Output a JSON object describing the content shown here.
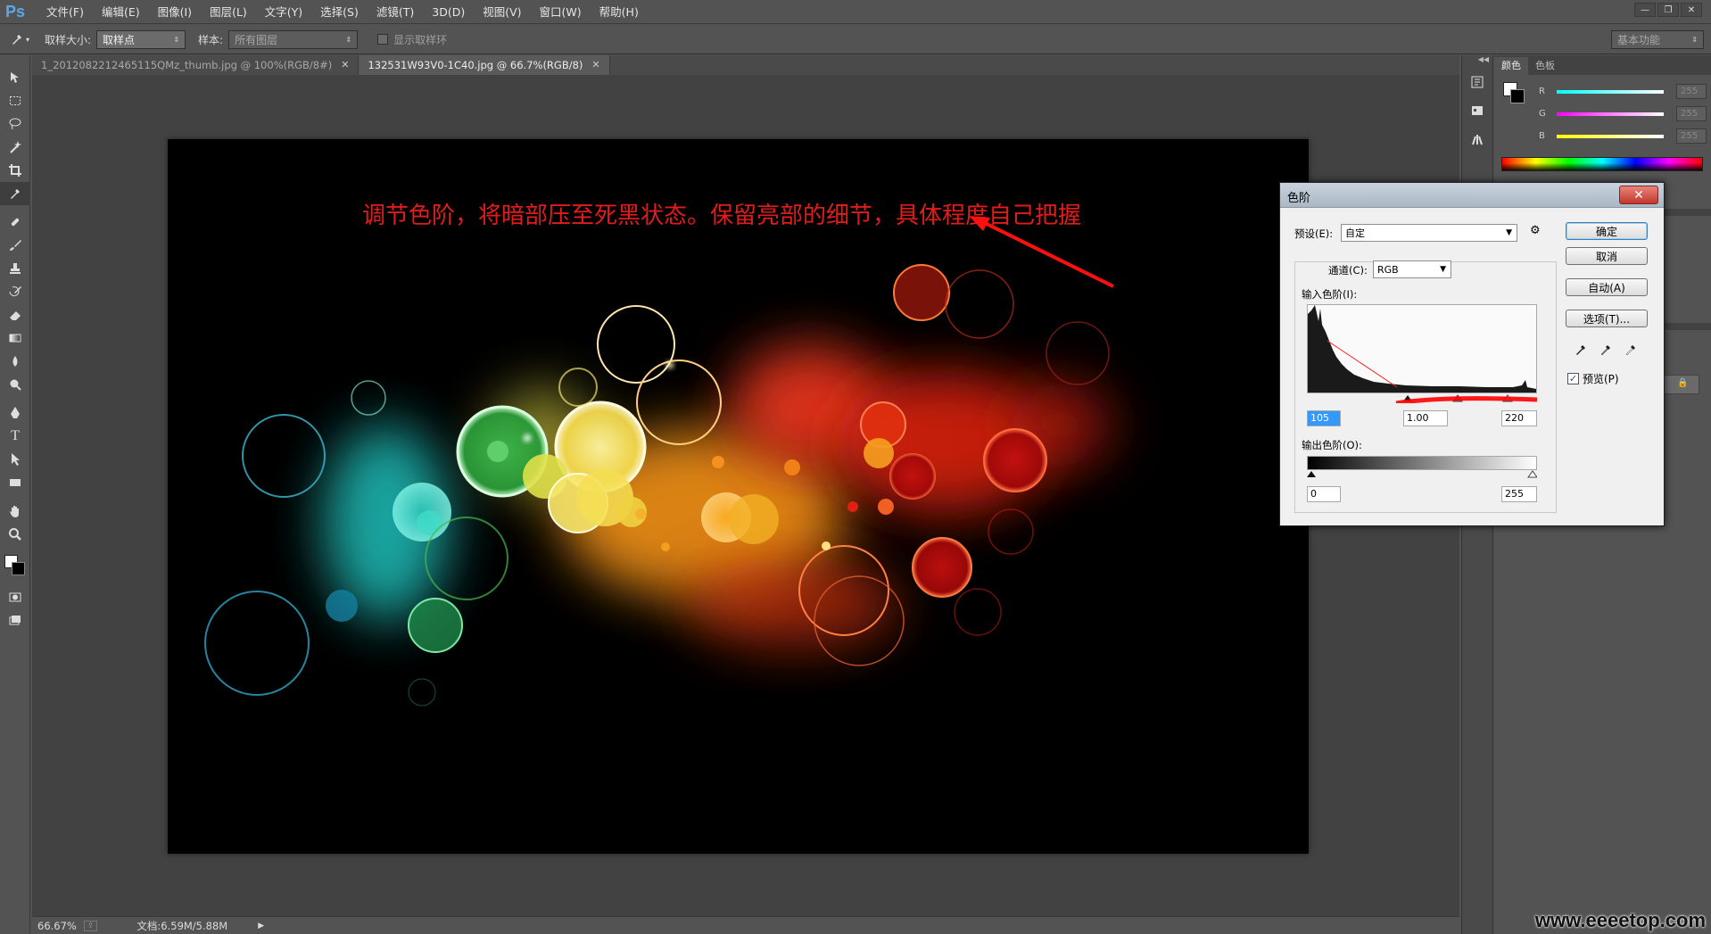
{
  "app": {
    "logo": "Ps",
    "menu": [
      "文件(F)",
      "编辑(E)",
      "图像(I)",
      "图层(L)",
      "文字(Y)",
      "选择(S)",
      "滤镜(T)",
      "3D(D)",
      "视图(V)",
      "窗口(W)",
      "帮助(H)"
    ]
  },
  "options_bar": {
    "sample_size_label": "取样大小:",
    "sample_size_value": "取样点",
    "sample_label": "样本:",
    "sample_value": "所有图层",
    "show_ring_label": "显示取样环",
    "workspace": "基本功能"
  },
  "tabs": [
    {
      "label": "1_2012082212465115QMz_thumb.jpg @ 100%(RGB/8#)",
      "active": false
    },
    {
      "label": "132531W93V0-1C40.jpg @ 66.7%(RGB/8)",
      "active": true
    }
  ],
  "canvas": {
    "annotation": "调节色阶，将暗部压至死黑状态。保留亮部的细节，具体程度自己把握"
  },
  "status": {
    "zoom": "66.67%",
    "doc_info": "文档:6.59M/5.88M"
  },
  "color_panel": {
    "tabs": [
      "颜色",
      "色板"
    ],
    "r_label": "R",
    "g_label": "G",
    "b_label": "B",
    "r_value": "255",
    "g_value": "255",
    "b_value": "255"
  },
  "levels": {
    "title": "色阶",
    "preset_label": "预设(E):",
    "preset_value": "自定",
    "channel_label": "通道(C):",
    "channel_value": "RGB",
    "input_label": "输入色阶(I):",
    "input_black": "105",
    "input_gamma": "1.00",
    "input_white": "220",
    "output_label": "输出色阶(O):",
    "output_black": "0",
    "output_white": "255",
    "ok": "确定",
    "cancel": "取消",
    "auto": "自动(A)",
    "options": "选项(T)...",
    "preview_label": "预览(P)",
    "preview_checked": true,
    "close": "✕"
  },
  "watermark": "www.eeeetop.com"
}
